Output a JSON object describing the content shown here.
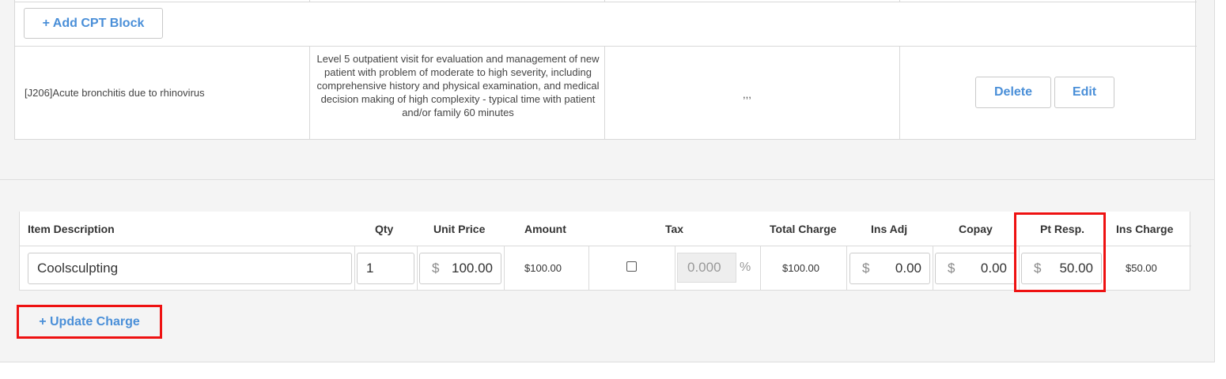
{
  "cpt": {
    "add_block_label": "+ Add CPT Block",
    "row": {
      "diagnosis": "[J206]Acute bronchitis due to rhinovirus",
      "description": "Level 5 outpatient visit for evaluation and management of new patient with problem of moderate to high severity, including comprehensive history and physical examination, and medical decision making of high complexity - typical time with patient and/or family 60 minutes",
      "modifiers": ",,,",
      "delete_label": "Delete",
      "edit_label": "Edit"
    }
  },
  "charge": {
    "headers": {
      "item_description": "Item Description",
      "qty": "Qty",
      "unit_price": "Unit Price",
      "amount": "Amount",
      "tax": "Tax",
      "total_charge": "Total Charge",
      "ins_adj": "Ins Adj",
      "copay": "Copay",
      "pt_resp": "Pt Resp.",
      "ins_charge": "Ins Charge"
    },
    "row": {
      "item_description": "Coolsculpting",
      "qty": "1",
      "unit_price": "100.00",
      "amount": "$100.00",
      "tax_checked": false,
      "tax_rate": "0.000",
      "tax_unit": "%",
      "total_charge": "$100.00",
      "ins_adj": "0.00",
      "copay": "0.00",
      "pt_resp": "50.00",
      "ins_charge": "$50.00"
    },
    "currency_symbol": "$",
    "update_label": "+ Update Charge"
  },
  "colors": {
    "accent": "#4a8fd8",
    "highlight": "#ee1111",
    "panel_bg": "#f4f4f4"
  }
}
